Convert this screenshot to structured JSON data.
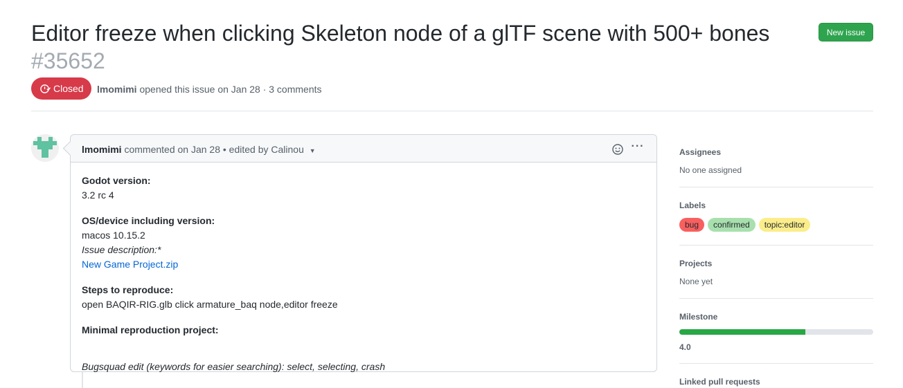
{
  "issue": {
    "title": "Editor freeze when clicking Skeleton node of a glTF scene with 500+ bones",
    "number": "#35652",
    "state": "Closed",
    "author": "lmomimi",
    "meta_rest": "opened this issue on Jan 28 · 3 comments",
    "new_issue_label": "New issue"
  },
  "comment": {
    "author": "lmomimi",
    "header_rest": "commented on Jan 28 • edited by Calinou",
    "body": {
      "godot_heading": "Godot version:",
      "godot_value": "3.2 rc 4",
      "os_heading": "OS/device including version:",
      "os_value": "macos 10.15.2",
      "issue_desc": "Issue description:*",
      "attachment": "New Game Project.zip",
      "steps_heading": "Steps to reproduce:",
      "steps_value": "open BAQIR-RIG.glb click armature_baq node,editor freeze",
      "minimal_heading": "Minimal reproduction project:",
      "bugsquad": "Bugsquad edit (keywords for easier searching): select, selecting, crash"
    }
  },
  "sidebar": {
    "assignees_title": "Assignees",
    "assignees_value": "No one assigned",
    "labels_title": "Labels",
    "labels": [
      {
        "name": "bug",
        "color": "#f85f5f"
      },
      {
        "name": "confirmed",
        "color": "#a8e0ad"
      },
      {
        "name": "topic:editor",
        "color": "#fbed8a"
      }
    ],
    "projects_title": "Projects",
    "projects_value": "None yet",
    "milestone_title": "Milestone",
    "milestone_progress": 0.65,
    "milestone_value": "4.0",
    "linked_title": "Linked pull requests"
  },
  "colors": {
    "closed": "#d73a49",
    "new_issue": "#2ea44f",
    "link": "#0366d6",
    "progress": "#28a745"
  }
}
